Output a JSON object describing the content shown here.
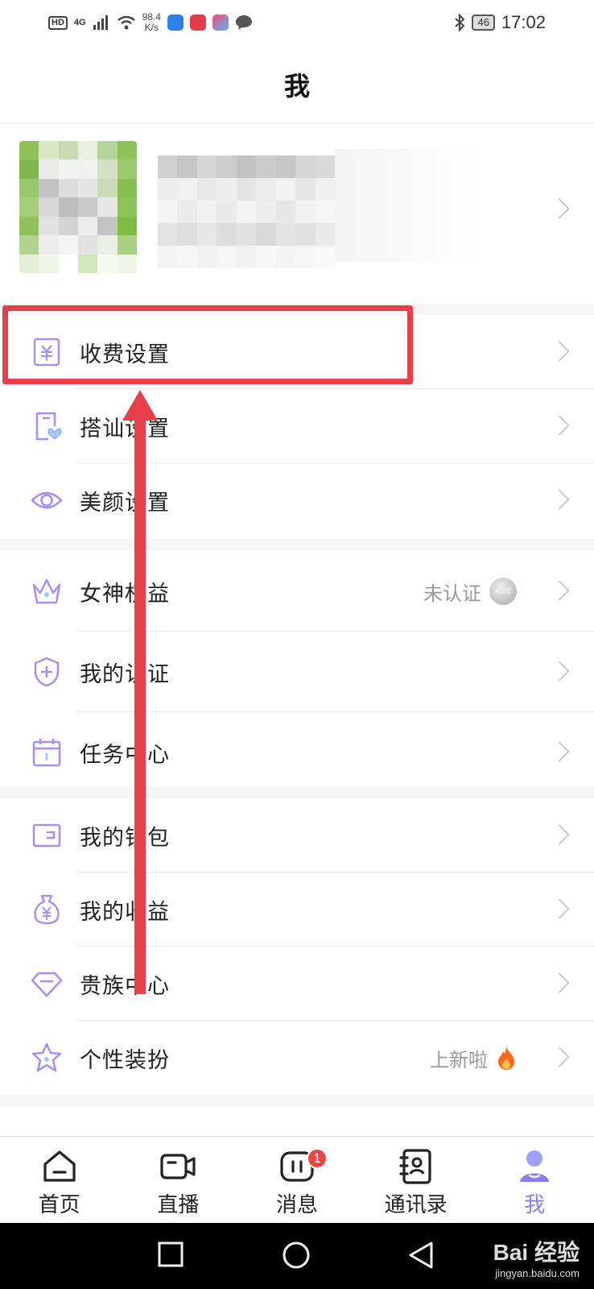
{
  "status_bar": {
    "hd": "HD",
    "network": "4G",
    "speed_value": "98.4",
    "speed_unit": "K/s",
    "battery": "46",
    "time": "17:02"
  },
  "header": {
    "title": "我"
  },
  "menu_group_1": [
    {
      "label": "收费设置",
      "icon": "fee-icon"
    },
    {
      "label": "搭讪设置",
      "icon": "chat-card-icon"
    },
    {
      "label": "美颜设置",
      "icon": "eye-icon"
    }
  ],
  "menu_group_2": [
    {
      "label": "女神权益",
      "icon": "crown-icon",
      "value": "未认证",
      "badge_text": "未认证"
    },
    {
      "label": "我的认证",
      "icon": "shield-plus-icon"
    },
    {
      "label": "任务中心",
      "icon": "calendar-icon"
    }
  ],
  "menu_group_3": [
    {
      "label": "我的钱包",
      "icon": "wallet-icon"
    },
    {
      "label": "我的收益",
      "icon": "money-bag-icon"
    },
    {
      "label": "贵族中心",
      "icon": "diamond-icon"
    },
    {
      "label": "个性装扮",
      "icon": "star-icon",
      "value": "上新啦"
    }
  ],
  "bottom_nav": [
    {
      "label": "首页",
      "icon": "home-icon"
    },
    {
      "label": "直播",
      "icon": "video-camera-icon"
    },
    {
      "label": "消息",
      "icon": "message-icon",
      "badge": "1"
    },
    {
      "label": "通讯录",
      "icon": "contacts-icon"
    },
    {
      "label": "我",
      "icon": "profile-icon",
      "active": true
    }
  ],
  "watermark": {
    "brand": "Bai 经验",
    "url": "jingyan.baidu.com"
  },
  "colors": {
    "accent": "#8a7cf0",
    "icon_purple": "#a98ef2",
    "highlight_red": "#e8404a",
    "badge_red": "#f04545"
  }
}
